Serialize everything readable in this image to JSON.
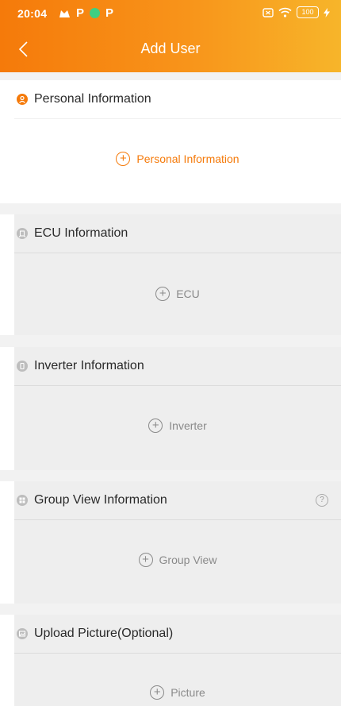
{
  "status": {
    "time": "20:04",
    "battery": "100"
  },
  "header": {
    "title": "Add User"
  },
  "colors": {
    "accent": "#f57a0a",
    "muted": "#9a9a9a"
  },
  "sections": [
    {
      "label": "Personal Information",
      "action": "Personal Information",
      "icon": "user-icon"
    },
    {
      "label": "ECU Information",
      "action": "ECU",
      "icon": "ecu-icon"
    },
    {
      "label": "Inverter Information",
      "action": "Inverter",
      "icon": "inverter-icon"
    },
    {
      "label": "Group View Information",
      "action": "Group View",
      "icon": "grid-icon"
    },
    {
      "label": "Upload Picture(Optional)",
      "action": "Picture",
      "icon": "image-icon"
    }
  ]
}
